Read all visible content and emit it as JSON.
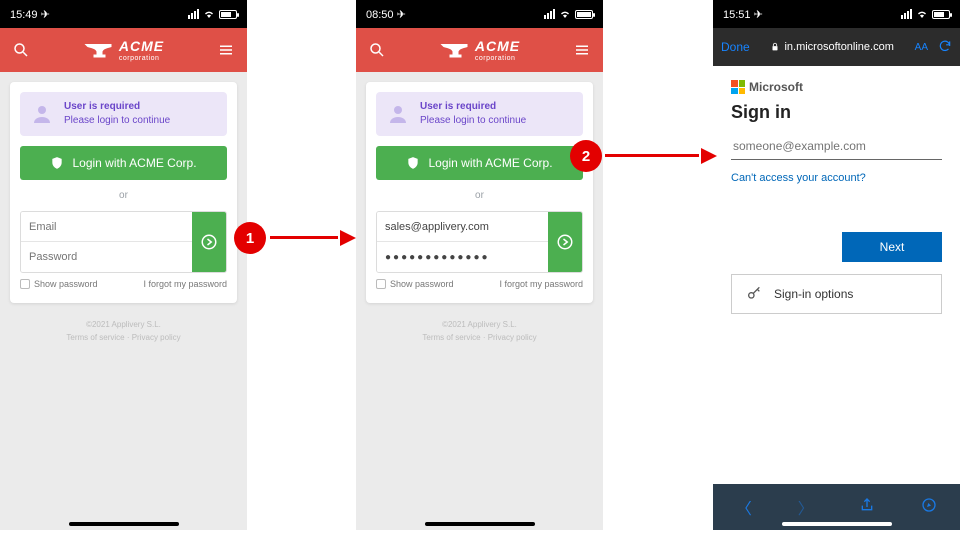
{
  "screens": [
    {
      "statusbar_time": "15:49",
      "alert_title": "User is required",
      "alert_text": "Please login to continue",
      "login_button": "Login with ACME Corp.",
      "or_text": "or",
      "email_placeholder": "Email",
      "email_value": "",
      "password_placeholder": "Password",
      "password_value": "",
      "show_password": "Show password",
      "forgot": "I forgot my password",
      "footer_line1": "©2021 Applivery S.L.",
      "footer_line2": "Terms of service ·  Privacy policy",
      "brand": "ACME",
      "brand_sub": "corporation"
    },
    {
      "statusbar_time": "08:50",
      "alert_title": "User is required",
      "alert_text": "Please login to continue",
      "login_button": "Login with ACME Corp.",
      "or_text": "or",
      "email_placeholder": "Email",
      "email_value": "sales@applivery.com",
      "password_placeholder": "Password",
      "password_value": "●●●●●●●●●●●●●",
      "show_password": "Show password",
      "forgot": "I forgot my password",
      "footer_line1": "©2021 Applivery S.L.",
      "footer_line2": "Terms of service ·  Privacy policy",
      "brand": "ACME",
      "brand_sub": "corporation"
    },
    {
      "statusbar_time": "15:51",
      "nav_done": "Done",
      "nav_url": "in.microsoftonline.com",
      "nav_aa": "AA",
      "ms_brand": "Microsoft",
      "signin_heading": "Sign in",
      "email_placeholder": "someone@example.com",
      "cant_access": "Can't access your account?",
      "next_button": "Next",
      "signin_options": "Sign-in options"
    }
  ],
  "annotations": {
    "badge1": "1",
    "badge2": "2"
  }
}
